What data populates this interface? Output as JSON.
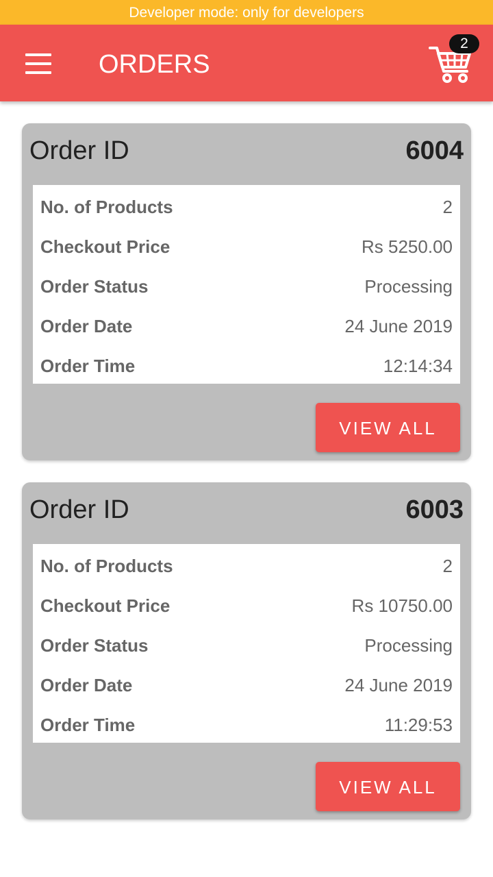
{
  "dev_banner": "Developer mode: only for developers",
  "appbar": {
    "title": "ORDERS",
    "menu_icon": "hamburger-menu-icon",
    "cart_icon": "shopping-cart-icon",
    "cart_count": "2"
  },
  "colors": {
    "accent": "#ef5350",
    "banner": "#fbb829",
    "card": "#bdbdbd"
  },
  "orders": [
    {
      "id_label": "Order ID",
      "id": "6004",
      "rows": [
        {
          "label": "No. of Products",
          "value": "2"
        },
        {
          "label": "Checkout Price",
          "value": "Rs 5250.00"
        },
        {
          "label": "Order Status",
          "value": "Processing"
        },
        {
          "label": "Order Date",
          "value": "24 June 2019"
        },
        {
          "label": "Order Time",
          "value": "12:14:34"
        }
      ],
      "button_label": "VIEW ALL"
    },
    {
      "id_label": "Order ID",
      "id": "6003",
      "rows": [
        {
          "label": "No. of Products",
          "value": "2"
        },
        {
          "label": "Checkout Price",
          "value": "Rs 10750.00"
        },
        {
          "label": "Order Status",
          "value": "Processing"
        },
        {
          "label": "Order Date",
          "value": "24 June 2019"
        },
        {
          "label": "Order Time",
          "value": "11:29:53"
        }
      ],
      "button_label": "VIEW ALL"
    }
  ]
}
